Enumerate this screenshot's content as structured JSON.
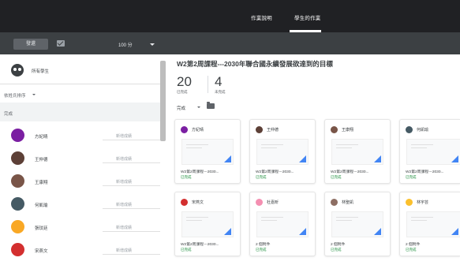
{
  "topbar": {
    "tabs": [
      "作業說明",
      "學生的作業"
    ],
    "active_tab": "學生的作業"
  },
  "toolbar": {
    "return_label": "發還",
    "points_label": "100 分"
  },
  "sidebar": {
    "all_students_label": "所有學生",
    "sort_label": "依姓氏排序",
    "section_label": "完成",
    "students": [
      {
        "name": "方紀晴",
        "status": "新增成績",
        "avatar_color": "#7b1fa2"
      },
      {
        "name": "王仲德",
        "status": "新增成績",
        "avatar_color": "#5d4037"
      },
      {
        "name": "王康翔",
        "status": "新增成績",
        "avatar_color": "#795548"
      },
      {
        "name": "何凱瑜",
        "status": "新增成績",
        "avatar_color": "#455a64"
      },
      {
        "name": "張玟廷",
        "status": "新增成績",
        "avatar_color": "#f9a825"
      },
      {
        "name": "宋燕文",
        "status": "新增成績",
        "avatar_color": "#d32f2f"
      }
    ]
  },
  "main": {
    "title": "W2第2周課程---2030年聯合國永續發展欲達到的目標",
    "stats": [
      {
        "value": "20",
        "label": "已完成"
      },
      {
        "value": "4",
        "label": "未完成"
      }
    ],
    "filter_label": "完成",
    "cards": [
      {
        "name": "方紀晴",
        "file": "W2第2周課程---2030...",
        "state": "已完成",
        "avatar_color": "#7b1fa2"
      },
      {
        "name": "王仲德",
        "file": "W2第2周課程---2030...",
        "state": "已完成",
        "avatar_color": "#5d4037"
      },
      {
        "name": "王康翔",
        "file": "W2第2周課程---2030...",
        "state": "已完成",
        "avatar_color": "#795548"
      },
      {
        "name": "何凱瑜",
        "file": "W2第2周課程---2030...",
        "state": "已完成",
        "avatar_color": "#455a64"
      },
      {
        "name": "宋燕文",
        "file": "W2第2周課程---2030...",
        "state": "已完成",
        "avatar_color": "#d32f2f"
      },
      {
        "name": "杜嘉昕",
        "file": "2 個附件",
        "state": "已完成",
        "avatar_color": "#f48fb1"
      },
      {
        "name": "林聖凱",
        "file": "2 個附件",
        "state": "已完成",
        "avatar_color": "#8d6e63"
      },
      {
        "name": "林宇芸",
        "file": "2 個附件",
        "state": "已完成",
        "avatar_color": "#fbc02d"
      }
    ]
  }
}
